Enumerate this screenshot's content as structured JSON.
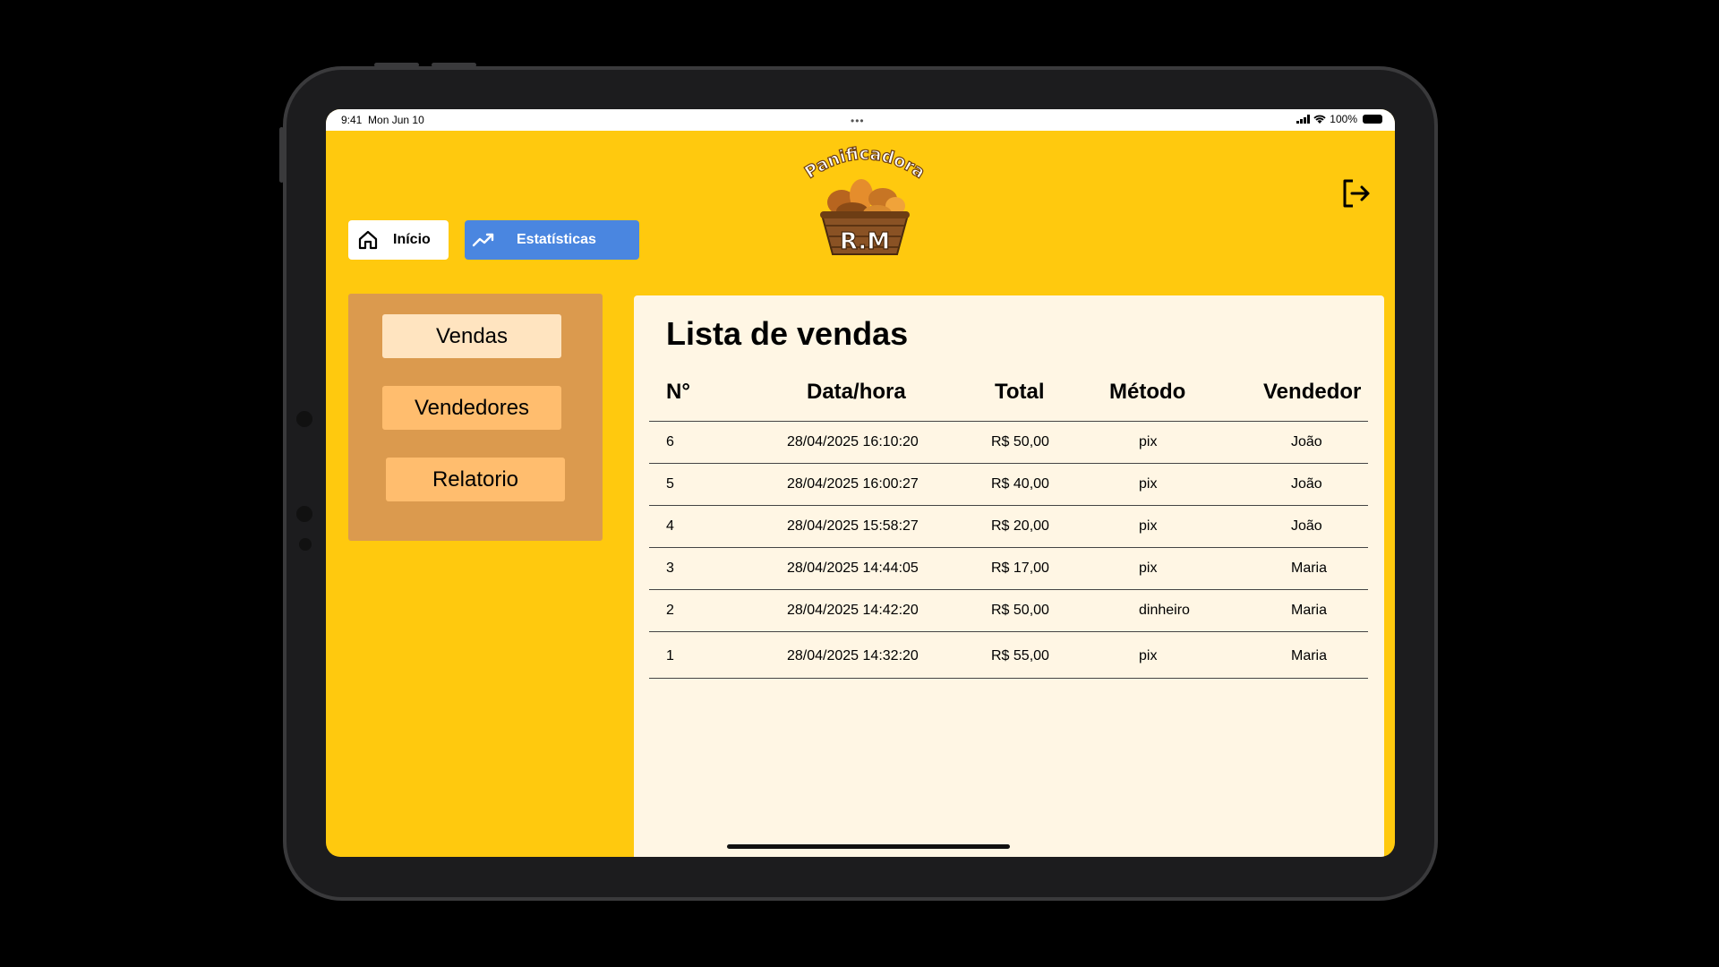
{
  "status": {
    "time": "9:41",
    "date": "Mon Jun 10",
    "dots": "•••",
    "battery": "100%"
  },
  "brand": {
    "top": "Panificadora",
    "bottom": "R.M"
  },
  "nav": {
    "home": "Início",
    "stats": "Estatísticas"
  },
  "sidebar": {
    "items": [
      "Vendas",
      "Vendedores",
      "Relatorio"
    ]
  },
  "sales": {
    "title": "Lista de vendas",
    "headers": [
      "N°",
      "Data/hora",
      "Total",
      "Método",
      "Vendedor"
    ],
    "rows": [
      [
        "6",
        "28/04/2025 16:10:20",
        "R$ 50,00",
        "pix",
        "João"
      ],
      [
        "5",
        "28/04/2025 16:00:27",
        "R$ 40,00",
        "pix",
        "João"
      ],
      [
        "4",
        "28/04/2025 15:58:27",
        "R$ 20,00",
        "pix",
        "João"
      ],
      [
        "3",
        "28/04/2025 14:44:05",
        "R$ 17,00",
        "pix",
        "Maria"
      ],
      [
        "2",
        "28/04/2025 14:42:20",
        "R$ 50,00",
        "dinheiro",
        "Maria"
      ],
      [
        "1",
        "28/04/2025 14:32:20",
        "R$ 55,00",
        "pix",
        "Maria"
      ]
    ]
  },
  "icons": {
    "home": "home-icon",
    "stats": "trending-up-icon",
    "logout": "logout-icon"
  },
  "colors": {
    "background": "#ffc90e",
    "stats_button": "#4a86e0",
    "sidebar": "#db9a4e",
    "panel": "#fff6e4"
  }
}
